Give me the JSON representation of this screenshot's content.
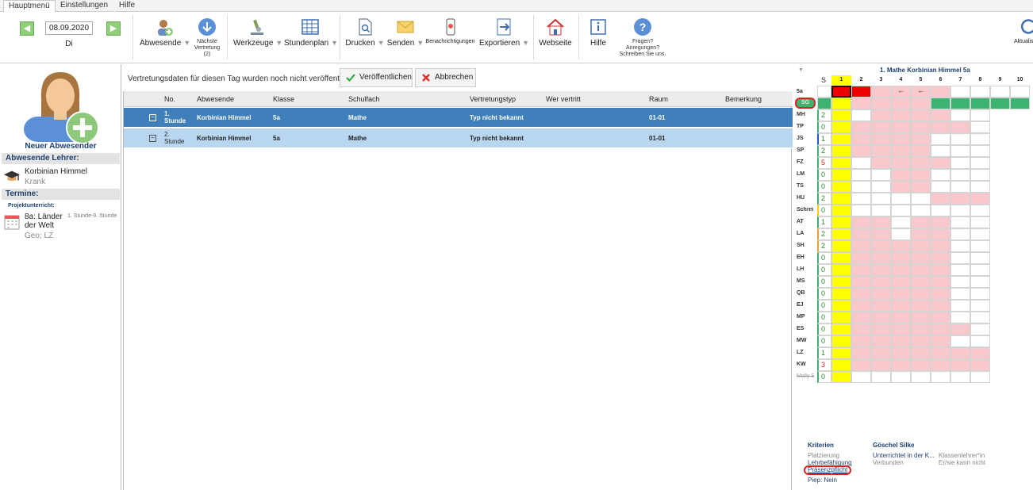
{
  "menu": {
    "tabs": [
      "Hauptmenü",
      "Einstellungen",
      "Hilfe"
    ]
  },
  "ribbon": {
    "date": "08.09.2020",
    "day": "Di",
    "buttons": {
      "absent": "Abwesende",
      "next": "Nächste Vertretung (2)",
      "tools": "Werkzeuge",
      "timetable": "Stundenplan",
      "print": "Drucken",
      "send": "Senden",
      "notifications": "Benachrichtigungen",
      "export": "Exportieren",
      "website": "Webseite",
      "help": "Hilfe",
      "questions": "Fragen? Anregungen? Schreiben Sie uns.",
      "refresh": "Aktualis"
    }
  },
  "left": {
    "new_absent": "Neuer Abwesender",
    "absent_header": "Abwesende Lehrer:",
    "teacher_name": "Korbinian Himmel",
    "teacher_status": "Krank",
    "events_header": "Termine:",
    "project_label": "Projektunterricht:",
    "event_title": "8a: Länder der Welt",
    "event_time": "1. Stunde-9. Stunde",
    "event_sub": "Geo; LZ"
  },
  "center": {
    "message": "Vertretungsdaten für diesen Tag wurden noch nicht veröffentlicht.",
    "publish_label": "Veröffentlichen",
    "cancel_label": "Abbrechen",
    "columns": [
      "No.",
      "Abwesende",
      "Klasse",
      "Schulfach",
      "Vertretungstyp",
      "Wer vertritt",
      "Raum",
      "Bemerkung"
    ],
    "rows": [
      {
        "no": "1. Stunde",
        "absent": "Korbinian Himmel",
        "class": "5a",
        "subject": "Mathe",
        "type": "Typ nicht bekannt",
        "who": "",
        "room": "01-01",
        "note": ""
      },
      {
        "no": "2. Stunde",
        "absent": "Korbinian Himmel",
        "class": "5a",
        "subject": "Mathe",
        "type": "Typ nicht bekannt",
        "who": "",
        "room": "01-01",
        "note": ""
      }
    ]
  },
  "right": {
    "title": "1. Mathe Korbinian Himmel 5a",
    "col_s": "S",
    "periods": [
      "1",
      "2",
      "3",
      "4",
      "5",
      "6",
      "7",
      "8",
      "9",
      "10"
    ],
    "class_row": "5a",
    "class_arrows": [
      "←",
      "←"
    ],
    "sel_teacher": "SG",
    "teachers": [
      {
        "code": "MH",
        "count": "2"
      },
      {
        "code": "TP",
        "count": "0"
      },
      {
        "code": "JS",
        "count": "1"
      },
      {
        "code": "SP",
        "count": "2"
      },
      {
        "code": "FZ",
        "count": "5"
      },
      {
        "code": "LM",
        "count": "0"
      },
      {
        "code": "TS",
        "count": "0"
      },
      {
        "code": "HU",
        "count": "2"
      },
      {
        "code": "Schrei",
        "count": "0"
      },
      {
        "code": "AT",
        "count": "1"
      },
      {
        "code": "LA",
        "count": "2"
      },
      {
        "code": "SH",
        "count": "2"
      },
      {
        "code": "EH",
        "count": "0"
      },
      {
        "code": "LH",
        "count": "0"
      },
      {
        "code": "MS",
        "count": "0"
      },
      {
        "code": "QB",
        "count": "0"
      },
      {
        "code": "EJ",
        "count": "0"
      },
      {
        "code": "MP",
        "count": "0"
      },
      {
        "code": "ES",
        "count": "0"
      },
      {
        "code": "MW",
        "count": "0"
      },
      {
        "code": "LZ",
        "count": "1"
      },
      {
        "code": "KW",
        "count": "3"
      },
      {
        "code": "Molly S",
        "count": "0"
      }
    ],
    "legend": {
      "criteria": "Kriterien",
      "name": "Göschel Silke",
      "placement": "Platzierung",
      "taught": "Unterrichtet in der K...",
      "class_teacher": "Klassenlehrer*in",
      "pref": "Lehrbefähigung",
      "connected": "Verbunden",
      "can_not": "Er/sie kann nicht",
      "presence": "Präsenzpflicht",
      "beep": "Piep: Nein"
    }
  }
}
